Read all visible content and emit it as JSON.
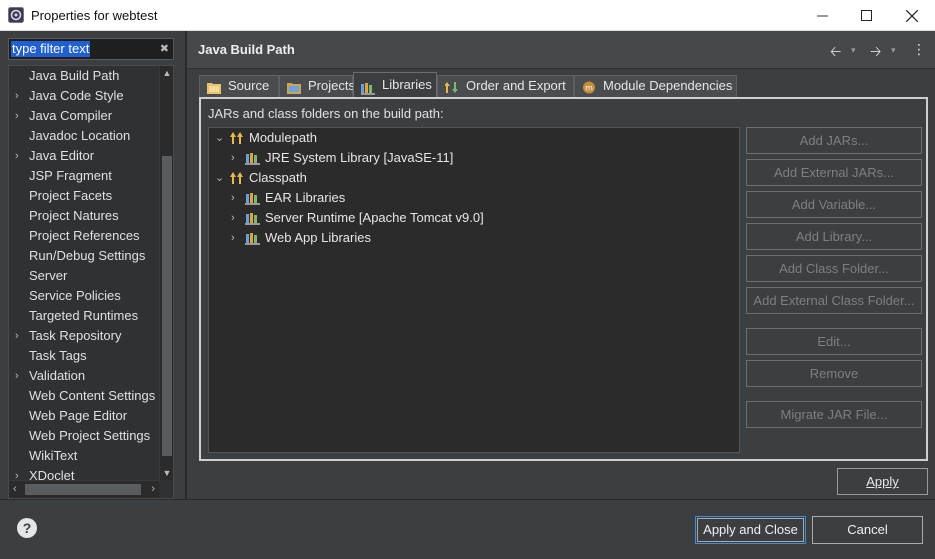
{
  "window": {
    "title": "Properties for webtest",
    "minimize": "—",
    "maximize": "☐",
    "close": "✕"
  },
  "filter": {
    "value": "type filter text",
    "clear": "✖"
  },
  "sidebar": {
    "items": [
      {
        "label": "Java Build Path",
        "expandable": false,
        "selected": true
      },
      {
        "label": "Java Code Style",
        "expandable": true
      },
      {
        "label": "Java Compiler",
        "expandable": true
      },
      {
        "label": "Javadoc Location",
        "expandable": false
      },
      {
        "label": "Java Editor",
        "expandable": true
      },
      {
        "label": "JSP Fragment",
        "expandable": false
      },
      {
        "label": "Project Facets",
        "expandable": false
      },
      {
        "label": "Project Natures",
        "expandable": false
      },
      {
        "label": "Project References",
        "expandable": false
      },
      {
        "label": "Run/Debug Settings",
        "expandable": false
      },
      {
        "label": "Server",
        "expandable": false
      },
      {
        "label": "Service Policies",
        "expandable": false
      },
      {
        "label": "Targeted Runtimes",
        "expandable": false
      },
      {
        "label": "Task Repository",
        "expandable": true
      },
      {
        "label": "Task Tags",
        "expandable": false
      },
      {
        "label": "Validation",
        "expandable": true
      },
      {
        "label": "Web Content Settings",
        "expandable": false
      },
      {
        "label": "Web Page Editor",
        "expandable": false
      },
      {
        "label": "Web Project Settings",
        "expandable": false
      },
      {
        "label": "WikiText",
        "expandable": false
      },
      {
        "label": "XDoclet",
        "expandable": true
      }
    ]
  },
  "page": {
    "title": "Java Build Path"
  },
  "tabs": [
    {
      "label": "Source",
      "icon": "source-folder-icon"
    },
    {
      "label": "Projects",
      "icon": "projects-icon"
    },
    {
      "label": "Libraries",
      "icon": "libraries-icon",
      "active": true
    },
    {
      "label": "Order and Export",
      "icon": "order-export-icon"
    },
    {
      "label": "Module Dependencies",
      "icon": "module-dependencies-icon"
    }
  ],
  "libraries": {
    "heading": "JARs and class folders on the build path:",
    "tree": [
      {
        "label": "Modulepath",
        "level": 0,
        "expanded": true,
        "icon": "path-icon"
      },
      {
        "label": "JRE System Library [JavaSE-11]",
        "level": 1,
        "expanded": false,
        "icon": "library-icon"
      },
      {
        "label": "Classpath",
        "level": 0,
        "expanded": true,
        "icon": "path-icon"
      },
      {
        "label": "EAR Libraries",
        "level": 1,
        "expanded": false,
        "icon": "library-icon"
      },
      {
        "label": "Server Runtime [Apache Tomcat v9.0]",
        "level": 1,
        "expanded": false,
        "icon": "library-icon"
      },
      {
        "label": "Web App Libraries",
        "level": 1,
        "expanded": false,
        "icon": "library-icon"
      }
    ],
    "buttons": [
      "Add JARs...",
      "Add External JARs...",
      "Add Variable...",
      "Add Library...",
      "Add Class Folder...",
      "Add External Class Folder...",
      "Edit...",
      "Remove",
      "Migrate JAR File..."
    ]
  },
  "actions": {
    "apply": "Apply",
    "apply_and_close": "Apply and Close",
    "cancel": "Cancel",
    "help": "?"
  },
  "colors": {
    "background": "#3c3f41",
    "selection": "#2060d0",
    "focus_border": "#3b8fd6",
    "tree_background": "#2b2b2b"
  }
}
